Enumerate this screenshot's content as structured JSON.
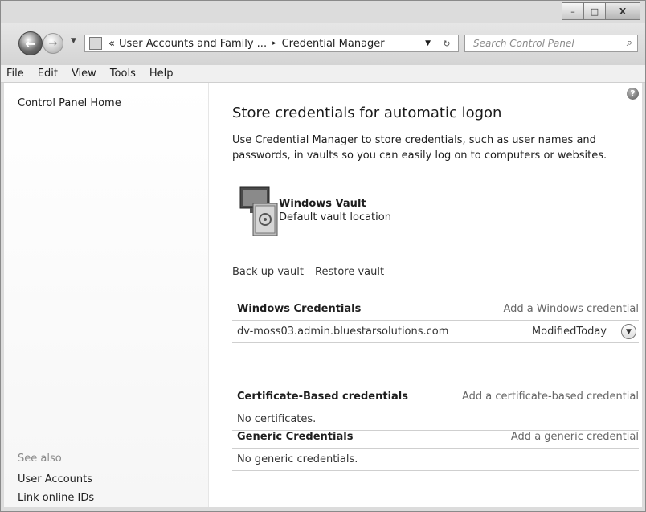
{
  "caption": {
    "minimize": "–",
    "maximize": "□",
    "close": "X"
  },
  "nav": {
    "breadcrumb_prefix": "«",
    "breadcrumb_1": "User Accounts and Family ...",
    "breadcrumb_sep": "▸",
    "breadcrumb_2": "Credential Manager",
    "search_placeholder": "Search Control Panel"
  },
  "menu": [
    "File",
    "Edit",
    "View",
    "Tools",
    "Help"
  ],
  "sidebar": {
    "home": "Control Panel Home",
    "see_also": "See also",
    "links": [
      "User Accounts",
      "Link online IDs"
    ]
  },
  "main": {
    "title": "Store credentials for automatic logon",
    "description": "Use Credential Manager to store credentials, such as user names and passwords, in vaults so you can easily log on to computers or websites.",
    "vault_name": "Windows Vault",
    "vault_location": "Default vault location",
    "backup": "Back up vault",
    "restore": "Restore vault",
    "sections": [
      {
        "title": "Windows Credentials",
        "add": "Add a Windows credential",
        "entry": "dv-moss03.admin.bluestarsolutions.com",
        "modified": "ModifiedToday"
      },
      {
        "title": "Certificate-Based credentials",
        "add": "Add a certificate-based credential",
        "entry": "No certificates."
      },
      {
        "title": "Generic Credentials",
        "add": "Add a generic credential",
        "entry": "No generic credentials."
      }
    ]
  }
}
